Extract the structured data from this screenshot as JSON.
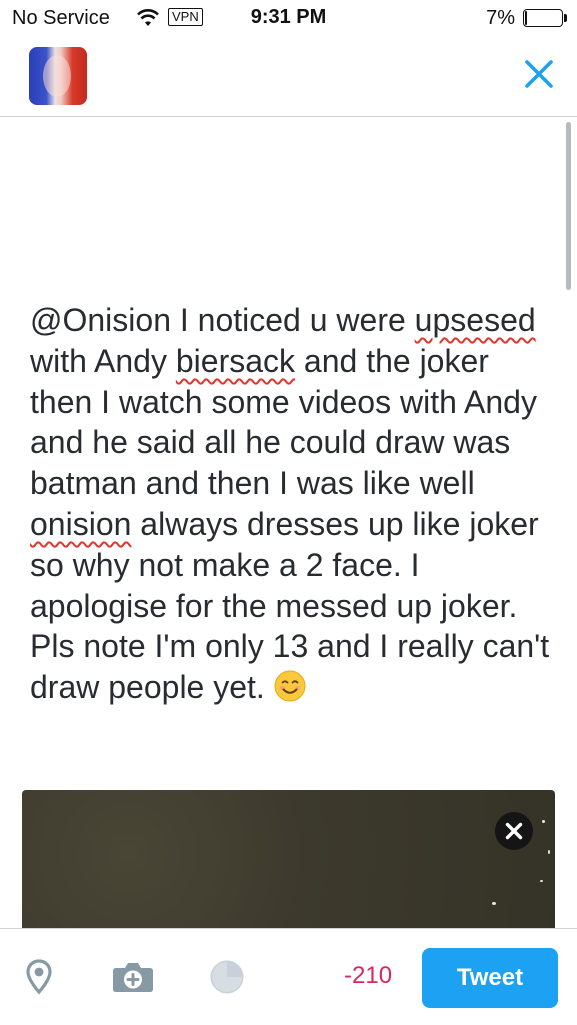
{
  "status_bar": {
    "carrier": "No Service",
    "vpn": "VPN",
    "time": "9:31 PM",
    "battery_percent": "7%",
    "battery_level": 0.07
  },
  "header": {
    "avatar_icon": "user-avatar",
    "close_icon": "close-icon"
  },
  "compose": {
    "text_parts": [
      "@Onision I noticed u were ",
      "upsesed",
      " with Andy ",
      "biersack",
      " and the joker then I watch some videos with Andy and he said all he could draw was batman and then I was like well ",
      "onision",
      " always dresses up like joker so why not make a 2 face. I apologise for the messed up joker. Pls note I'm only 13 and I really can't draw people yet. "
    ],
    "emoji": "smiling-face-emoji",
    "attached_photo_remove_icon": "close-icon"
  },
  "toolbar": {
    "location_icon": "location-pin-icon",
    "camera_icon": "camera-add-icon",
    "progress_icon": "character-progress-icon",
    "char_count": "-210",
    "tweet_label": "Tweet"
  },
  "colors": {
    "accent": "#1da1f2",
    "over_limit": "#e0245e",
    "spellcheck": "#e2352b"
  }
}
